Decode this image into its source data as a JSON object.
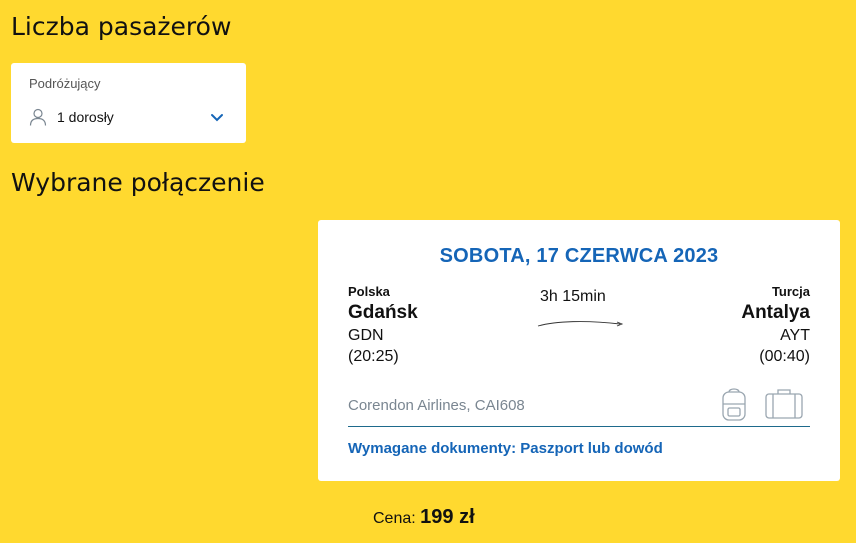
{
  "titles": {
    "passengers": "Liczba pasażerów",
    "selected_connection": "Wybrane połączenie"
  },
  "passengers": {
    "label": "Podróżujący",
    "value": "1 dorosły",
    "icon": "person-icon",
    "dropdown_icon": "chevron-down-icon"
  },
  "flight": {
    "date": "SOBOTA, 17 CZERWCA 2023",
    "duration": "3h 15min",
    "origin": {
      "country": "Polska",
      "city": "Gdańsk",
      "code": "GDN",
      "time": "(20:25)"
    },
    "destination": {
      "country": "Turcja",
      "city": "Antalya",
      "code": "AYT",
      "time": "(00:40)"
    },
    "airline": "Corendon Airlines, CAI608",
    "documents": "Wymagane dokumenty: Paszport lub dowód",
    "icons": [
      "backpack-icon",
      "suitcase-icon"
    ]
  },
  "price": {
    "label": "Cena:",
    "amount": "199 zł"
  },
  "colors": {
    "background": "#FFD92F",
    "accent": "#1565B7"
  }
}
